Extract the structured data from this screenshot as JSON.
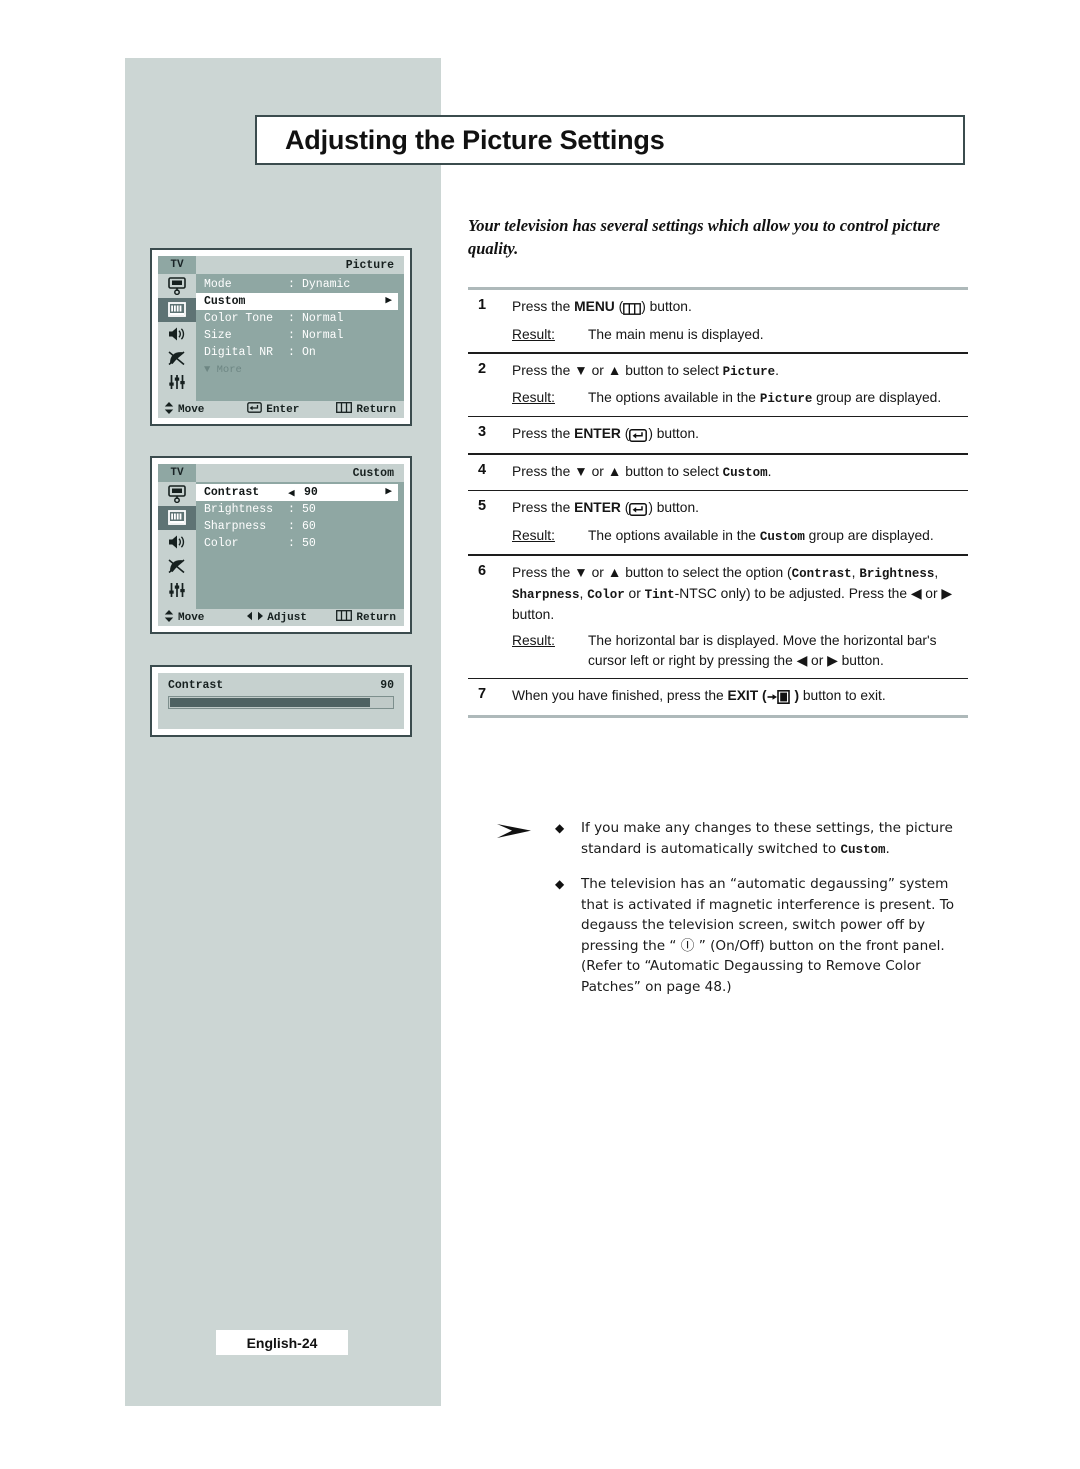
{
  "page": {
    "title": "Adjusting the Picture Settings",
    "footer_label": "English-24"
  },
  "intro": {
    "text": "Your television has several settings which allow you to control picture quality."
  },
  "osd_menus": [
    {
      "id": "picture-menu",
      "tv_chip": "TV",
      "header_title": "Picture",
      "rows": [
        {
          "label": "Mode",
          "colon": ":",
          "value": "Dynamic",
          "highlight": false
        },
        {
          "label": "Custom",
          "colon": "",
          "value": "",
          "highlight": true
        },
        {
          "label": "Color Tone",
          "colon": ":",
          "value": "Normal",
          "highlight": false
        },
        {
          "label": "Size",
          "colon": ":",
          "value": "Normal",
          "highlight": false
        },
        {
          "label": "Digital NR",
          "colon": ":",
          "value": "On",
          "highlight": false
        }
      ],
      "more_label": "More",
      "footer": {
        "move": "Move",
        "middle": "Enter",
        "return": "Return"
      },
      "icons": [
        "tv-input-icon",
        "picture-bars-icon",
        "speaker-icon",
        "satellite-dish-icon",
        "sliders-icon"
      ],
      "active_icon_index": 1
    },
    {
      "id": "custom-menu",
      "tv_chip": "TV",
      "header_title": "Custom",
      "rows": [
        {
          "label": "Contrast",
          "colon": "",
          "value": "90",
          "highlight": true
        },
        {
          "label": "Brightness",
          "colon": ":",
          "value": "50",
          "highlight": false
        },
        {
          "label": "Sharpness",
          "colon": ":",
          "value": "60",
          "highlight": false
        },
        {
          "label": "Color",
          "colon": ":",
          "value": "50",
          "highlight": false
        }
      ],
      "footer": {
        "move": "Move",
        "middle": "Adjust",
        "return": "Return"
      },
      "icons": [
        "tv-input-icon",
        "picture-bars-icon",
        "speaker-icon",
        "satellite-dish-icon",
        "sliders-icon"
      ],
      "active_icon_index": 1
    }
  ],
  "contrast_popup": {
    "label": "Contrast",
    "value": "90",
    "fill_percent": 90
  },
  "steps": [
    {
      "num": "1",
      "body_parts": [
        {
          "t": "Press the ",
          "s": "plain"
        },
        {
          "t": "MENU",
          "s": "bold"
        },
        {
          "t": " (",
          "s": "plain"
        },
        {
          "t": "menu-icon",
          "s": "glyph-menu"
        },
        {
          "t": ") button.",
          "s": "plain"
        }
      ],
      "result_label": "Result:",
      "result_parts": [
        {
          "t": "The main menu is displayed.",
          "s": "plain"
        }
      ]
    },
    {
      "num": "2",
      "body_parts": [
        {
          "t": "Press the ",
          "s": "plain"
        },
        {
          "t": "▼",
          "s": "plain"
        },
        {
          "t": " or ",
          "s": "plain"
        },
        {
          "t": "▲",
          "s": "plain"
        },
        {
          "t": " button to select ",
          "s": "plain"
        },
        {
          "t": "Picture",
          "s": "mono"
        },
        {
          "t": ".",
          "s": "plain"
        }
      ],
      "result_label": "Result:",
      "result_parts": [
        {
          "t": "The options available in the ",
          "s": "plain"
        },
        {
          "t": "Picture",
          "s": "mono"
        },
        {
          "t": " group are displayed.",
          "s": "plain"
        }
      ]
    },
    {
      "num": "3",
      "body_parts": [
        {
          "t": "Press the ",
          "s": "plain"
        },
        {
          "t": "ENTER",
          "s": "bold"
        },
        {
          "t": " (",
          "s": "plain"
        },
        {
          "t": "enter-icon",
          "s": "glyph-enter"
        },
        {
          "t": ") button.",
          "s": "plain"
        }
      ],
      "result_label": "",
      "result_parts": []
    },
    {
      "num": "4",
      "body_parts": [
        {
          "t": "Press the ",
          "s": "plain"
        },
        {
          "t": "▼",
          "s": "plain"
        },
        {
          "t": " or ",
          "s": "plain"
        },
        {
          "t": "▲",
          "s": "plain"
        },
        {
          "t": " button to select ",
          "s": "plain"
        },
        {
          "t": "Custom",
          "s": "mono"
        },
        {
          "t": ".",
          "s": "plain"
        }
      ],
      "result_label": "",
      "result_parts": []
    },
    {
      "num": "5",
      "body_parts": [
        {
          "t": "Press the ",
          "s": "plain"
        },
        {
          "t": "ENTER",
          "s": "bold"
        },
        {
          "t": " (",
          "s": "plain"
        },
        {
          "t": "enter-icon",
          "s": "glyph-enter"
        },
        {
          "t": ") button.",
          "s": "plain"
        }
      ],
      "result_label": "Result:",
      "result_parts": [
        {
          "t": "The options available in the ",
          "s": "plain"
        },
        {
          "t": "Custom",
          "s": "mono"
        },
        {
          "t": " group are displayed.",
          "s": "plain"
        }
      ]
    },
    {
      "num": "6",
      "body_parts": [
        {
          "t": "Press the ",
          "s": "plain"
        },
        {
          "t": "▼",
          "s": "plain"
        },
        {
          "t": " or ",
          "s": "plain"
        },
        {
          "t": "▲",
          "s": "plain"
        },
        {
          "t": " button to select the option (",
          "s": "plain"
        },
        {
          "t": "Contrast",
          "s": "mono"
        },
        {
          "t": ", ",
          "s": "plain"
        },
        {
          "t": "Brightness",
          "s": "mono"
        },
        {
          "t": ", ",
          "s": "plain"
        },
        {
          "t": "Sharpness",
          "s": "mono"
        },
        {
          "t": ", ",
          "s": "plain"
        },
        {
          "t": "Color",
          "s": "mono"
        },
        {
          "t": " or ",
          "s": "plain"
        },
        {
          "t": "Tint",
          "s": "mono"
        },
        {
          "t": "-NTSC only) to be adjusted. Press the ",
          "s": "plain"
        },
        {
          "t": "◀",
          "s": "plain"
        },
        {
          "t": " or ",
          "s": "plain"
        },
        {
          "t": "▶",
          "s": "plain"
        },
        {
          "t": " button.",
          "s": "plain"
        }
      ],
      "result_label": "Result:",
      "result_parts": [
        {
          "t": "The horizontal bar is displayed. Move the horizontal bar's cursor left or right by pressing the ",
          "s": "plain"
        },
        {
          "t": "◀",
          "s": "plain"
        },
        {
          "t": " or ",
          "s": "plain"
        },
        {
          "t": "▶",
          "s": "plain"
        },
        {
          "t": " button.",
          "s": "plain"
        }
      ]
    },
    {
      "num": "7",
      "body_parts": [
        {
          "t": "When you have finished, press the ",
          "s": "plain"
        },
        {
          "t": "EXIT (",
          "s": "bold"
        },
        {
          "t": "exit-icon",
          "s": "glyph-exit"
        },
        {
          "t": " )",
          "s": "bold"
        },
        {
          "t": " button to exit.",
          "s": "plain"
        }
      ],
      "result_label": "",
      "result_parts": []
    }
  ],
  "notes": {
    "arrow_icon": "note-arrow-icon",
    "items": [
      {
        "bullet": "◆",
        "parts": [
          {
            "t": "If you make any changes to these settings, the picture standard is automatically switched to ",
            "s": "plain"
          },
          {
            "t": "Custom",
            "s": "mono"
          },
          {
            "t": ".",
            "s": "plain"
          }
        ]
      },
      {
        "bullet": "◆",
        "parts": [
          {
            "t": "The television has an “automatic degaussing” system that is activated if magnetic interference is present. To degauss the television screen, switch power off by pressing the “ ",
            "s": "plain"
          },
          {
            "t": "Ⓘ",
            "s": "power-glyph"
          },
          {
            "t": " ” (On/Off) button on the front panel. (Refer to “Automatic Degaussing to Remove Color Patches” on page 48.)",
            "s": "plain"
          }
        ]
      }
    ]
  },
  "colors": {
    "panel_gray": "#ccd6d4",
    "osd_light": "#c6d1cf",
    "osd_mid": "#8fa7a3",
    "osd_dark": "#5e7374",
    "bar_fill": "#4e6262",
    "border": "#3b4c4e",
    "rule_gray": "#aeb9ba"
  }
}
